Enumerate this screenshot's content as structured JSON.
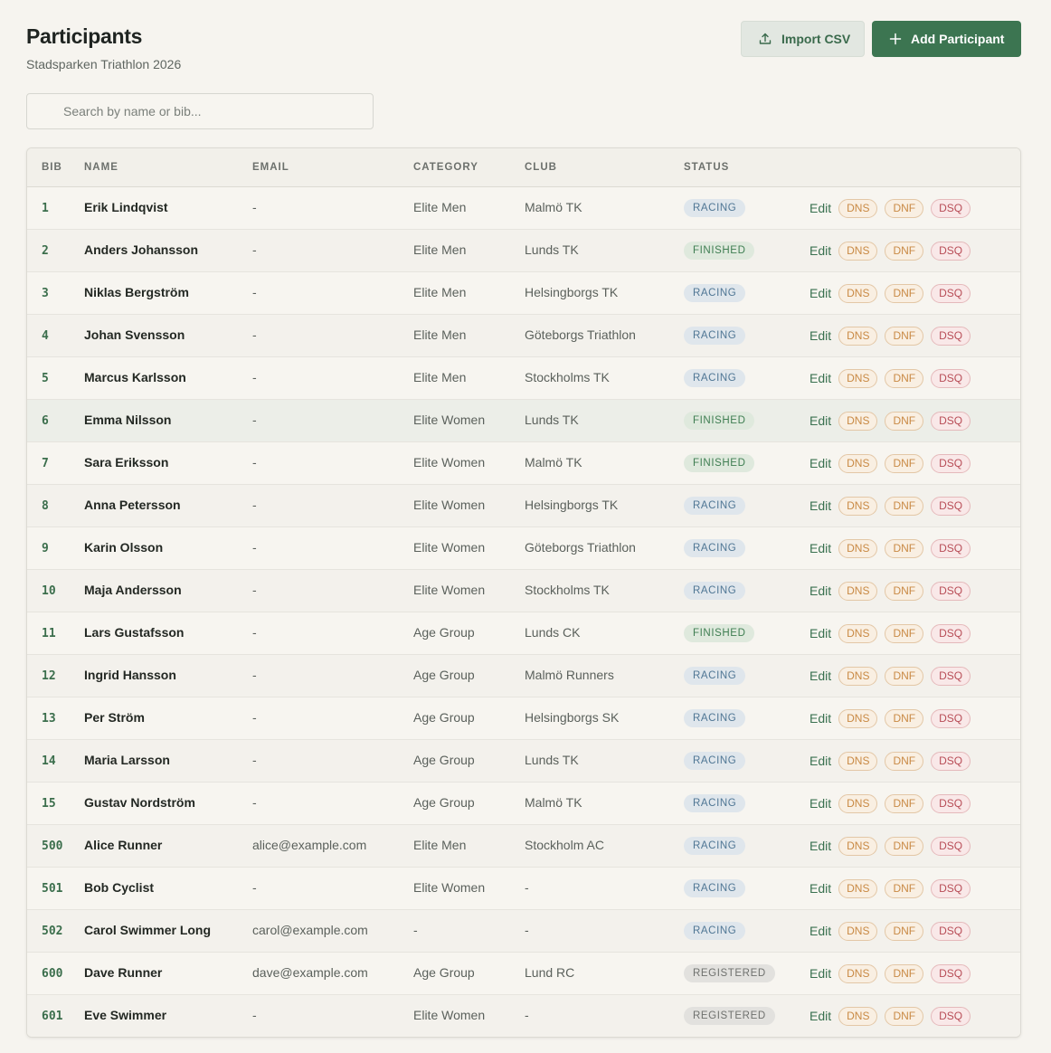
{
  "page": {
    "title": "Participants",
    "subtitle": "Stadsparken Triathlon 2026"
  },
  "actions": {
    "import_label": "Import CSV",
    "add_label": "Add Participant"
  },
  "search": {
    "placeholder": "Search by name or bib...",
    "value": ""
  },
  "colors": {
    "primary": "#3c7551",
    "racing": "#4f7694",
    "finished": "#3f7e52",
    "registered": "#6f716e",
    "dns": "#c98a45",
    "dsq": "#b84d57"
  },
  "table": {
    "columns": [
      "BIB",
      "NAME",
      "EMAIL",
      "CATEGORY",
      "CLUB",
      "STATUS"
    ],
    "action_labels": {
      "edit": "Edit",
      "dns": "DNS",
      "dnf": "DNF",
      "dsq": "DSQ"
    },
    "rows": [
      {
        "bib": "1",
        "name": "Erik Lindqvist",
        "email": "-",
        "category": "Elite Men",
        "club": "Malmö TK",
        "status": "RACING"
      },
      {
        "bib": "2",
        "name": "Anders Johansson",
        "email": "-",
        "category": "Elite Men",
        "club": "Lunds TK",
        "status": "FINISHED"
      },
      {
        "bib": "3",
        "name": "Niklas Bergström",
        "email": "-",
        "category": "Elite Men",
        "club": "Helsingborgs TK",
        "status": "RACING"
      },
      {
        "bib": "4",
        "name": "Johan Svensson",
        "email": "-",
        "category": "Elite Men",
        "club": "Göteborgs Triathlon",
        "status": "RACING"
      },
      {
        "bib": "5",
        "name": "Marcus Karlsson",
        "email": "-",
        "category": "Elite Men",
        "club": "Stockholms TK",
        "status": "RACING"
      },
      {
        "bib": "6",
        "name": "Emma Nilsson",
        "email": "-",
        "category": "Elite Women",
        "club": "Lunds TK",
        "status": "FINISHED"
      },
      {
        "bib": "7",
        "name": "Sara Eriksson",
        "email": "-",
        "category": "Elite Women",
        "club": "Malmö TK",
        "status": "FINISHED"
      },
      {
        "bib": "8",
        "name": "Anna Petersson",
        "email": "-",
        "category": "Elite Women",
        "club": "Helsingborgs TK",
        "status": "RACING"
      },
      {
        "bib": "9",
        "name": "Karin Olsson",
        "email": "-",
        "category": "Elite Women",
        "club": "Göteborgs Triathlon",
        "status": "RACING"
      },
      {
        "bib": "10",
        "name": "Maja Andersson",
        "email": "-",
        "category": "Elite Women",
        "club": "Stockholms TK",
        "status": "RACING"
      },
      {
        "bib": "11",
        "name": "Lars Gustafsson",
        "email": "-",
        "category": "Age Group",
        "club": "Lunds CK",
        "status": "FINISHED"
      },
      {
        "bib": "12",
        "name": "Ingrid Hansson",
        "email": "-",
        "category": "Age Group",
        "club": "Malmö Runners",
        "status": "RACING"
      },
      {
        "bib": "13",
        "name": "Per Ström",
        "email": "-",
        "category": "Age Group",
        "club": "Helsingborgs SK",
        "status": "RACING"
      },
      {
        "bib": "14",
        "name": "Maria Larsson",
        "email": "-",
        "category": "Age Group",
        "club": "Lunds TK",
        "status": "RACING"
      },
      {
        "bib": "15",
        "name": "Gustav Nordström",
        "email": "-",
        "category": "Age Group",
        "club": "Malmö TK",
        "status": "RACING"
      },
      {
        "bib": "500",
        "name": "Alice Runner",
        "email": "alice@example.com",
        "category": "Elite Men",
        "club": "Stockholm AC",
        "status": "RACING"
      },
      {
        "bib": "501",
        "name": "Bob Cyclist",
        "email": "-",
        "category": "Elite Women",
        "club": "-",
        "status": "RACING"
      },
      {
        "bib": "502",
        "name": "Carol Swimmer Long",
        "email": "carol@example.com",
        "category": "-",
        "club": "-",
        "status": "RACING"
      },
      {
        "bib": "600",
        "name": "Dave Runner",
        "email": "dave@example.com",
        "category": "Age Group",
        "club": "Lund RC",
        "status": "REGISTERED"
      },
      {
        "bib": "601",
        "name": "Eve Swimmer",
        "email": "-",
        "category": "Elite Women",
        "club": "-",
        "status": "REGISTERED"
      }
    ]
  }
}
